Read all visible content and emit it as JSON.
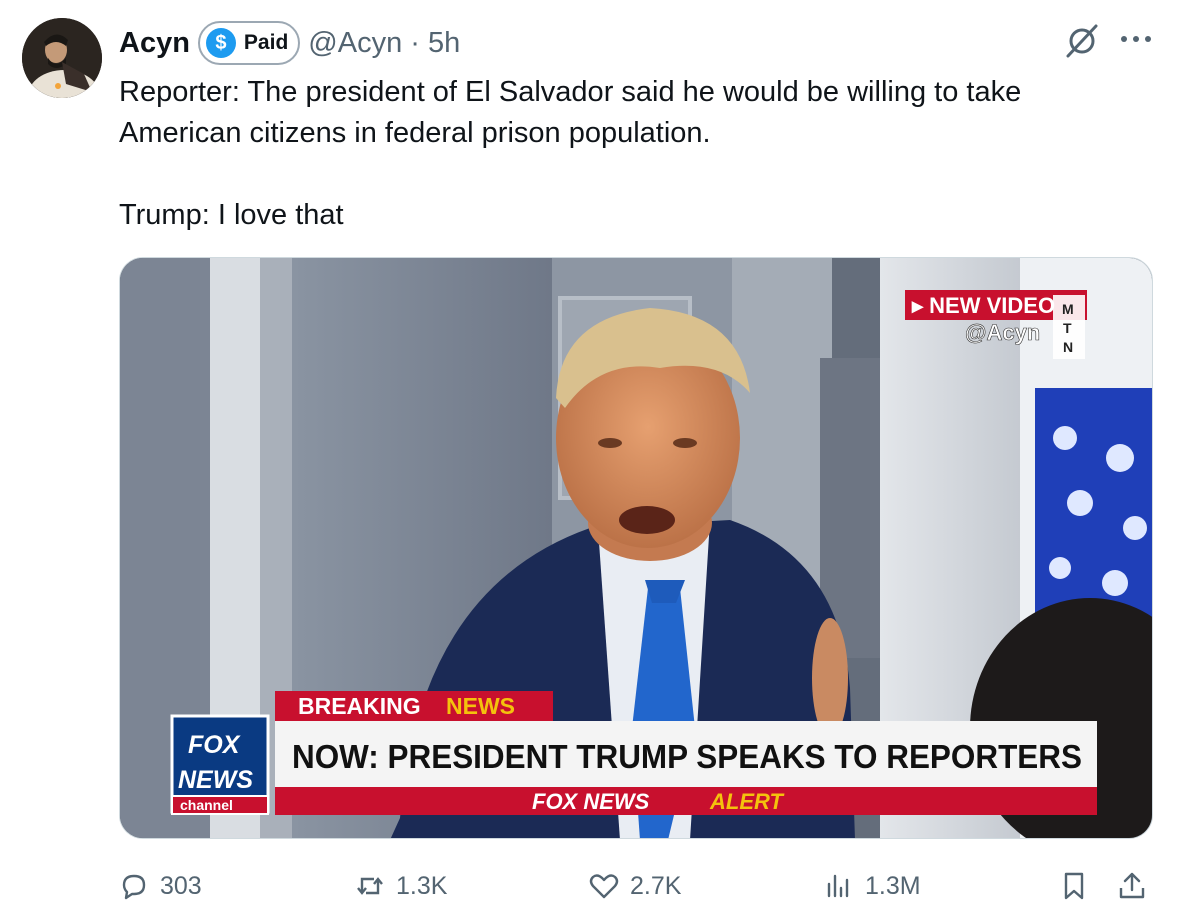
{
  "author": {
    "display_name": "Acyn",
    "badge_label": "Paid",
    "badge_icon": "dollar-sign-icon",
    "handle_time": "@Acyn · 5h"
  },
  "tweet": {
    "text": "Reporter: The president of El Salvador said he would be willing to take\nAmerican citizens in federal prison population.\n\nTrump: I love that"
  },
  "media": {
    "overlay_new_video": "▸ NEW VIDEO",
    "overlay_handle": "@Acyn",
    "overlay_mtn": [
      "M",
      "T",
      "N"
    ],
    "breaking": "BREAKING",
    "news": "NEWS",
    "headline": "NOW: PRESIDENT TRUMP SPEAKS TO REPORTERS",
    "alert_a": "FOX NEWS",
    "alert_b": "ALERT",
    "logo_fox": "FOX",
    "logo_news": "NEWS",
    "logo_channel": "channel"
  },
  "actions": {
    "replies": "303",
    "reposts": "1.3K",
    "likes": "2.7K",
    "views": "1.3M"
  },
  "colors": {
    "accent": "#1d9bf0",
    "muted": "#536471",
    "fox_red": "#c8102e",
    "fox_blue": "#003366"
  }
}
